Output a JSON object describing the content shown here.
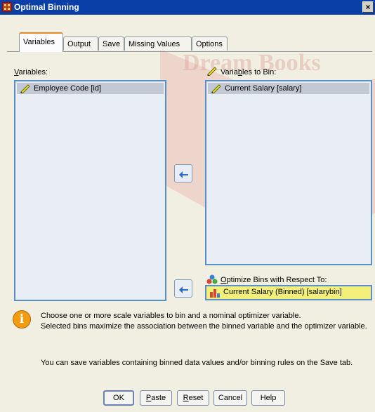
{
  "window": {
    "title": "Optimal Binning",
    "close_glyph": "×"
  },
  "watermark": {
    "text": "Dream Books"
  },
  "tabs": [
    {
      "label": "Variables",
      "active": true
    },
    {
      "label": "Output",
      "active": false
    },
    {
      "label": "Save",
      "active": false
    },
    {
      "label": "Missing Values",
      "active": false
    },
    {
      "label": "Options",
      "active": false
    }
  ],
  "variables": {
    "label_pre": "",
    "label_u": "V",
    "label_post": "ariables:",
    "items": [
      {
        "label": "Employee Code [id]",
        "icon": "scale-ruler-icon"
      }
    ]
  },
  "bin": {
    "label_pre": "Varia",
    "label_u": "b",
    "label_post": "les to Bin:",
    "items": [
      {
        "label": "Current Salary [salary]",
        "icon": "scale-ruler-icon"
      }
    ]
  },
  "optimize": {
    "label_pre": "",
    "label_u": "O",
    "label_post": "ptimize Bins with Respect To:",
    "value": "Current Salary (Binned) [salarybin]",
    "icon": "nominal-bars-icon",
    "box_color": "#f2f07a"
  },
  "info": {
    "icon": "info-icon",
    "line1": "Choose one or more scale variables to bin and a nominal optimizer variable.",
    "line2": "Selected bins maximize the association between the binned variable and the optimizer variable.",
    "line3": "You can save variables containing binned data values and/or binning rules on the Save tab."
  },
  "buttons": {
    "ok": "OK",
    "paste_u": "P",
    "paste_rest": "aste",
    "reset_u": "R",
    "reset_rest": "eset",
    "cancel": "Cancel",
    "help": "Help"
  },
  "colors": {
    "titlebar": "#0b3fa8",
    "list_bg": "#e9edf4",
    "list_border": "#5b8fc7",
    "selected_item": "#c3c9d4",
    "dialog_bg": "#f1efe2",
    "tab_accent": "#e68b2c"
  }
}
